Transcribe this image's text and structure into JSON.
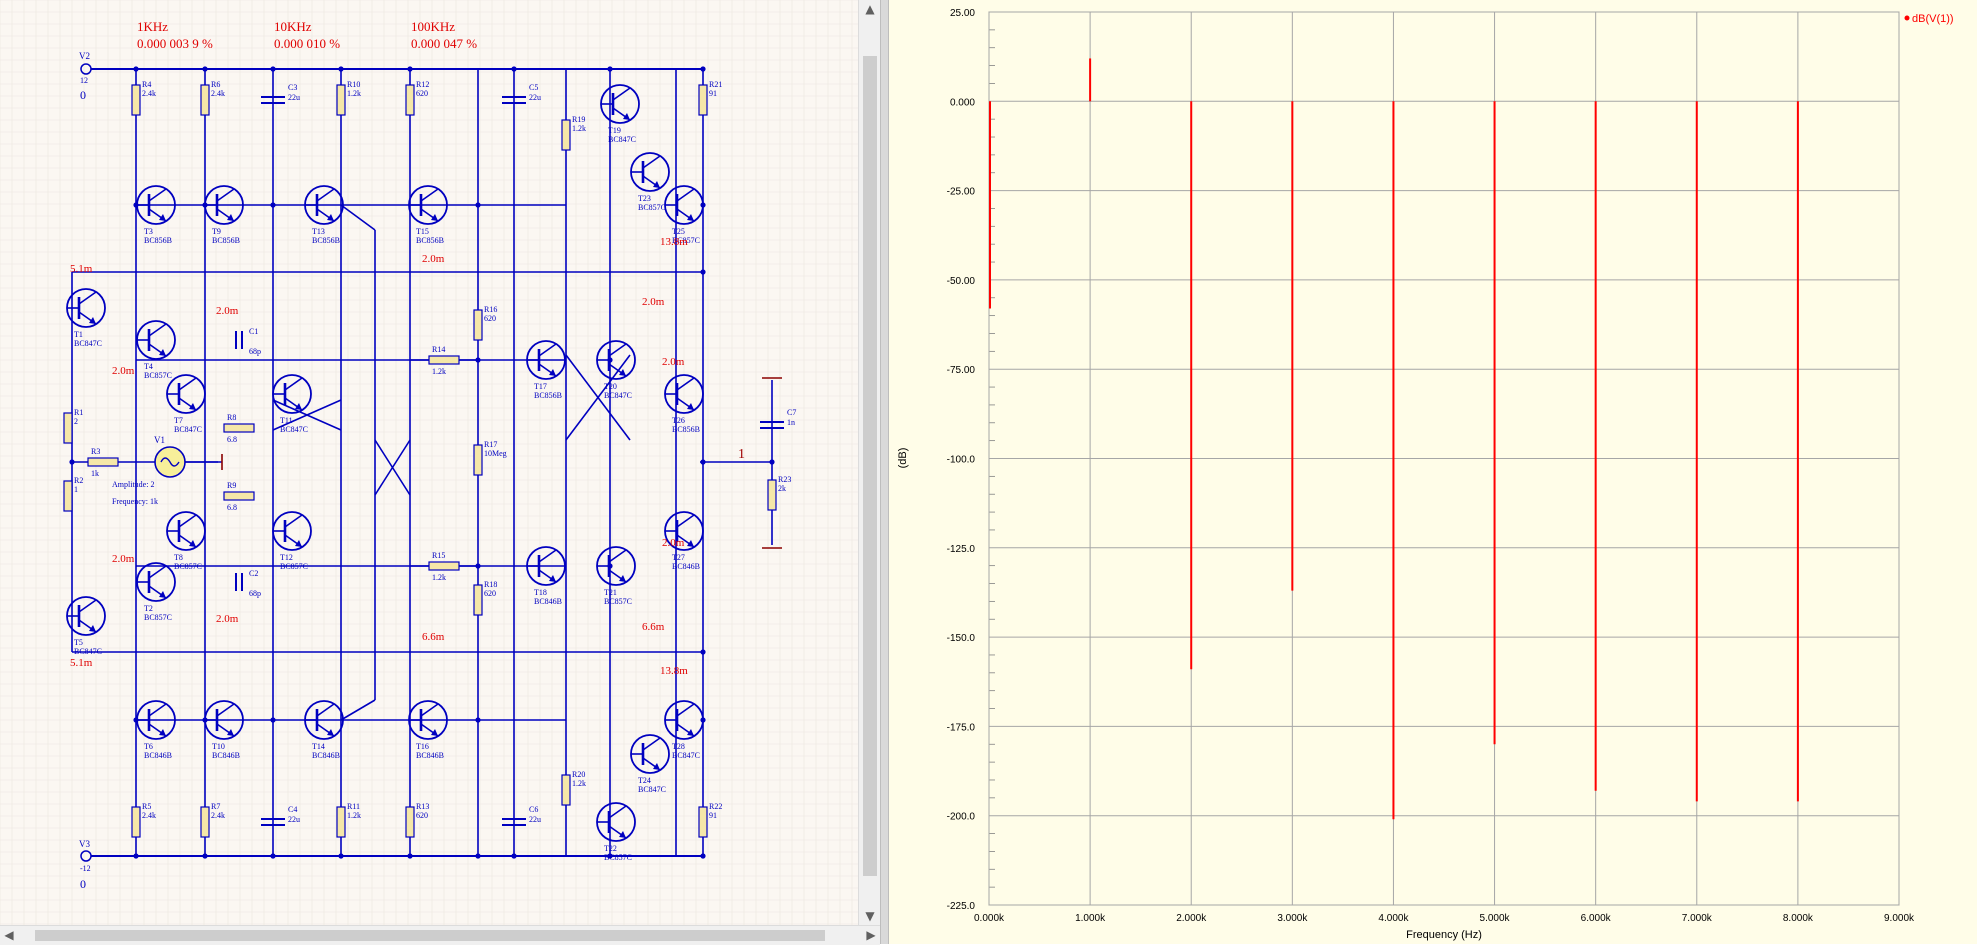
{
  "schematic": {
    "freq_labels": [
      {
        "freq": "1KHz",
        "thd": "0.000 003 9 %"
      },
      {
        "freq": "10KHz",
        "thd": "0.000 010 %"
      },
      {
        "freq": "100KHz",
        "thd": "0.000 047 %"
      }
    ],
    "supply_pos": {
      "name": "V2",
      "value": "12",
      "current": "0"
    },
    "supply_neg": {
      "name": "V3",
      "value": "-12",
      "current": "0"
    },
    "source": {
      "name": "V1",
      "amplitude": "Amplitude: 2",
      "frequency": "Frequency: 1k"
    },
    "output_node": "1",
    "resistors": [
      {
        "name": "R4",
        "value": "2.4k"
      },
      {
        "name": "R6",
        "value": "2.4k"
      },
      {
        "name": "R10",
        "value": "1.2k"
      },
      {
        "name": "R12",
        "value": "620"
      },
      {
        "name": "R19",
        "value": "1.2k"
      },
      {
        "name": "R21",
        "value": "91"
      },
      {
        "name": "R1",
        "value": "2"
      },
      {
        "name": "R2",
        "value": "1"
      },
      {
        "name": "R3",
        "value": "1k"
      },
      {
        "name": "R8",
        "value": "6.8"
      },
      {
        "name": "R9",
        "value": "6.8"
      },
      {
        "name": "R14",
        "value": "1.2k"
      },
      {
        "name": "R15",
        "value": "1.2k"
      },
      {
        "name": "R16",
        "value": "620"
      },
      {
        "name": "R17",
        "value": "10Meg"
      },
      {
        "name": "R18",
        "value": "620"
      },
      {
        "name": "R23",
        "value": "2k"
      },
      {
        "name": "R5",
        "value": "2.4k"
      },
      {
        "name": "R7",
        "value": "2.4k"
      },
      {
        "name": "R11",
        "value": "1.2k"
      },
      {
        "name": "R13",
        "value": "620"
      },
      {
        "name": "R20",
        "value": "1.2k"
      },
      {
        "name": "R22",
        "value": "91"
      }
    ],
    "capacitors": [
      {
        "name": "C3",
        "value": "22u"
      },
      {
        "name": "C5",
        "value": "22u"
      },
      {
        "name": "C1",
        "value": "68p"
      },
      {
        "name": "C2",
        "value": "68p"
      },
      {
        "name": "C7",
        "value": "1n"
      },
      {
        "name": "C4",
        "value": "22u"
      },
      {
        "name": "C6",
        "value": "22u"
      }
    ],
    "transistors": [
      {
        "name": "T3",
        "model": "BC856B"
      },
      {
        "name": "T9",
        "model": "BC856B"
      },
      {
        "name": "T13",
        "model": "BC856B"
      },
      {
        "name": "T15",
        "model": "BC856B"
      },
      {
        "name": "T19",
        "model": "BC847C"
      },
      {
        "name": "T23",
        "model": "BC857C"
      },
      {
        "name": "T25",
        "model": "BC857C"
      },
      {
        "name": "T1",
        "model": "BC847C"
      },
      {
        "name": "T4",
        "model": "BC857C"
      },
      {
        "name": "T7",
        "model": "BC847C"
      },
      {
        "name": "T11",
        "model": "BC847C"
      },
      {
        "name": "T17",
        "model": "BC856B"
      },
      {
        "name": "T20",
        "model": "BC847C"
      },
      {
        "name": "T26",
        "model": "BC856B"
      },
      {
        "name": "T8",
        "model": "BC857C"
      },
      {
        "name": "T12",
        "model": "BC857C"
      },
      {
        "name": "T2",
        "model": "BC857C"
      },
      {
        "name": "T5",
        "model": "BC847C"
      },
      {
        "name": "T18",
        "model": "BC846B"
      },
      {
        "name": "T21",
        "model": "BC857C"
      },
      {
        "name": "T27",
        "model": "BC846B"
      },
      {
        "name": "T6",
        "model": "BC846B"
      },
      {
        "name": "T10",
        "model": "BC846B"
      },
      {
        "name": "T14",
        "model": "BC846B"
      },
      {
        "name": "T16",
        "model": "BC846B"
      },
      {
        "name": "T24",
        "model": "BC847C"
      },
      {
        "name": "T28",
        "model": "BC847C"
      },
      {
        "name": "T22",
        "model": "BC857C"
      }
    ],
    "currents": [
      "5.1m",
      "2.0m",
      "2.0m",
      "2.0m",
      "2.0m",
      "2.0m",
      "2.0m",
      "2.0m",
      "2.0m",
      "6.6m",
      "6.6m",
      "13.8m",
      "13.8m",
      "5.1m"
    ],
    "colors": {
      "wire": "#0000c0",
      "label": "#e00000",
      "component": "#0000b4"
    }
  },
  "chart_data": {
    "type": "bar",
    "title": "",
    "xlabel": "Frequency (Hz)",
    "ylabel": "(dB)",
    "xlim": [
      0,
      9000
    ],
    "ylim": [
      -225,
      25
    ],
    "x_ticks": [
      "0.000k",
      "1.000k",
      "2.000k",
      "3.000k",
      "4.000k",
      "5.000k",
      "6.000k",
      "7.000k",
      "8.000k",
      "9.000k"
    ],
    "y_ticks": [
      "25.00",
      "0.000",
      "-25.00",
      "-50.00",
      "-75.00",
      "-100.0",
      "-125.0",
      "-150.0",
      "-175.0",
      "-200.0",
      "-225.0"
    ],
    "grid": true,
    "legend_position": "top-right",
    "series": [
      {
        "name": "dB(V(1))",
        "color": "#ff0000",
        "x": [
          0,
          1000,
          2000,
          3000,
          4000,
          5000,
          6000,
          7000,
          8000
        ],
        "values": [
          -58,
          12,
          -159,
          -137,
          -201,
          -180,
          -193,
          -196,
          -196
        ]
      }
    ]
  }
}
